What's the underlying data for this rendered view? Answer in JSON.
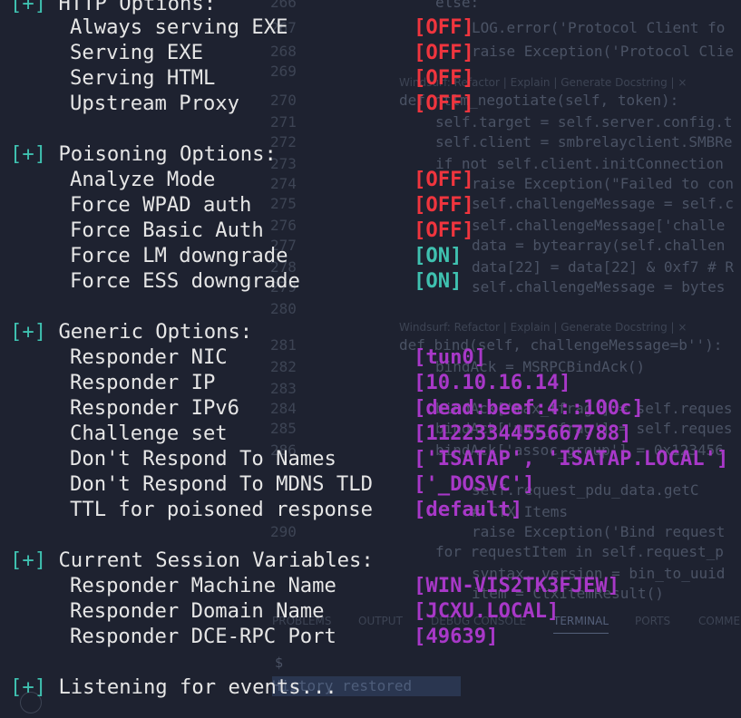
{
  "editor": {
    "lines": [
      {
        "num": "266",
        "code": "else:"
      },
      {
        "num": "267",
        "code": "LOG.error('Protocol Client fo"
      },
      {
        "num": "268",
        "code": "raise Exception('Protocol Clie"
      },
      {
        "num": "269",
        "code": ""
      },
      {
        "num": "270",
        "code": "def ntlm_negotiate(self, token):"
      },
      {
        "num": "271",
        "code": "self.target = self.server.config.t"
      },
      {
        "num": "272",
        "code": "self.client = smbrelayclient.SMBRe"
      },
      {
        "num": "273",
        "code": "if not self.client.initConnection"
      },
      {
        "num": "274",
        "code": "raise Exception(\"Failed to con"
      },
      {
        "num": "275",
        "code": "self.challengeMessage = self.c"
      },
      {
        "num": "276",
        "code": "self.challengeMessage['challe"
      },
      {
        "num": "277",
        "code": "data = bytearray(self.challen"
      },
      {
        "num": "278",
        "code": "data[22] = data[22] & 0xf7 # R"
      },
      {
        "num": "279",
        "code": "self.challengeMessage = bytes"
      },
      {
        "num": "280",
        "code": ""
      },
      {
        "num": "281",
        "code": "def bind(self, challengeMessage=b''):"
      },
      {
        "num": "282",
        "code": "bindAck = MSRPCBindAck()"
      },
      {
        "num": "283",
        "code": ""
      },
      {
        "num": "284",
        "code": "bindAck['max_tfrag'] = self.reques"
      },
      {
        "num": "285",
        "code": "bindAck['max_rfrag'] = self.reques"
      },
      {
        "num": "286",
        "code": "bindAck['assoc_group'] = 0x123456"
      },
      {
        "num": "287",
        "code": "self.request_pdu_data.getC"
      },
      {
        "num": "288",
        "code": "# CTX Items"
      },
      {
        "num": "290",
        "code": "raise Exception('Bind request"
      },
      {
        "num": "291",
        "code": "for requestItem in self.request_p"
      },
      {
        "num": "292",
        "code": "syntax, version = bin_to_uuid"
      },
      {
        "num": "293",
        "code": "item = CtxItemResult()"
      }
    ],
    "hint": "Windsurf: Refactor | Explain | Generate Docstring | ×",
    "panel_tabs": [
      "PROBLEMS",
      "OUTPUT",
      "DEBUG CONSOLE",
      "TERMINAL",
      "PORTS",
      "COMMENTS"
    ],
    "history": "History restored",
    "prompt": "$"
  },
  "terminal": {
    "http": {
      "header": "HTTP Options:",
      "items": [
        {
          "label": "Always serving EXE",
          "value": "[OFF]",
          "state": "off"
        },
        {
          "label": "Serving EXE",
          "value": "[OFF]",
          "state": "off"
        },
        {
          "label": "Serving HTML",
          "value": "[OFF]",
          "state": "off"
        },
        {
          "label": "Upstream Proxy",
          "value": "[OFF]",
          "state": "off"
        }
      ]
    },
    "poisoning": {
      "header": "Poisoning Options:",
      "items": [
        {
          "label": "Analyze Mode",
          "value": "[OFF]",
          "state": "off"
        },
        {
          "label": "Force WPAD auth",
          "value": "[OFF]",
          "state": "off"
        },
        {
          "label": "Force Basic Auth",
          "value": "[OFF]",
          "state": "off"
        },
        {
          "label": "Force LM downgrade",
          "value": "[ON]",
          "state": "on"
        },
        {
          "label": "Force ESS downgrade",
          "value": "[ON]",
          "state": "on"
        }
      ]
    },
    "generic": {
      "header": "Generic Options:",
      "items": [
        {
          "label": "Responder NIC",
          "value": "[tun0]"
        },
        {
          "label": "Responder IP",
          "value": "[10.10.16.14]"
        },
        {
          "label": "Responder IPv6",
          "value": "[dead:beef:4::100c]"
        },
        {
          "label": "Challenge set",
          "value": "[1122334455667788]"
        },
        {
          "label": "Don't Respond To Names",
          "value": "['ISATAP', 'ISATAP.LOCAL']"
        },
        {
          "label": "Don't Respond To MDNS TLD",
          "value": "['_DOSVC']"
        },
        {
          "label": "TTL for poisoned response",
          "value": "[default]"
        }
      ]
    },
    "session": {
      "header": "Current Session Variables:",
      "items": [
        {
          "label": "Responder Machine Name",
          "value": "[WIN-VIS2TK3FJEW]"
        },
        {
          "label": "Responder Domain Name",
          "value": "[JCXU.LOCAL]"
        },
        {
          "label": "Responder DCE-RPC Port",
          "value": "[49639]"
        }
      ]
    },
    "tag": "[+]",
    "listening": "Listening for events...",
    "colors": {
      "tag": "#3fc1b0",
      "off": "#f0353e",
      "on": "#3fc1b0",
      "value": "#a838c8"
    }
  }
}
